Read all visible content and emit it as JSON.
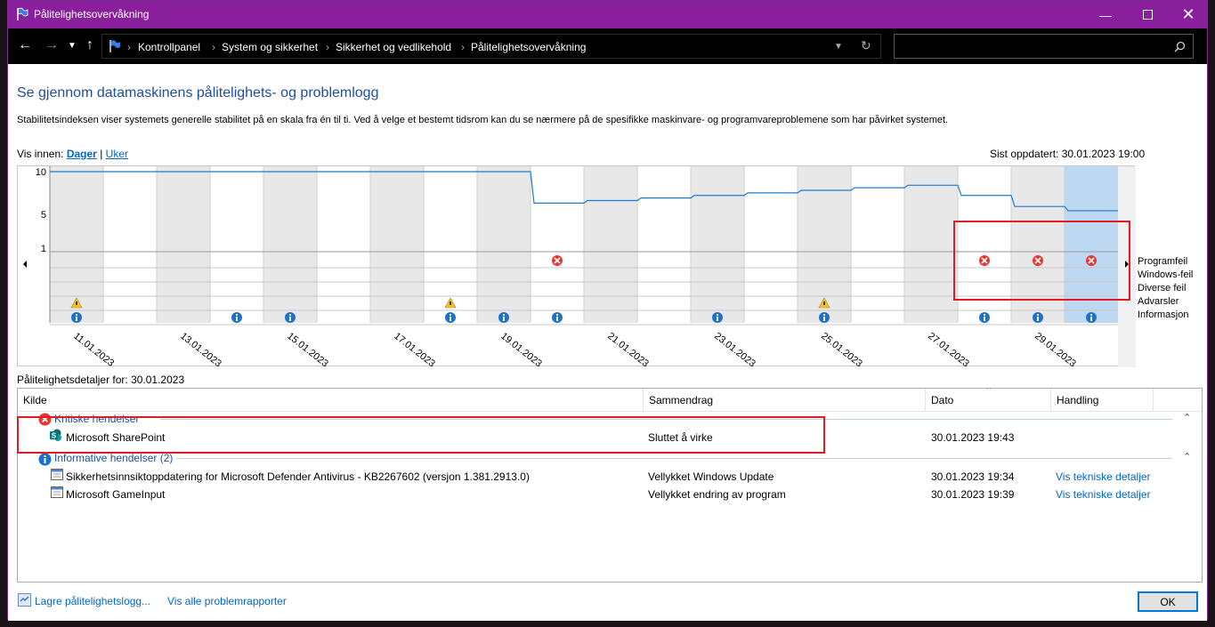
{
  "window": {
    "title": "Pålitelighetsovervåkning",
    "title_color": "#8a1f9e"
  },
  "address": {
    "crumbs": [
      "Kontrollpanel",
      "System og sikkerhet",
      "Sikkerhet og vedlikehold",
      "Pålitelighetsovervåkning"
    ]
  },
  "main": {
    "heading": "Se gjennom datamaskinens pålitelighets- og problemlogg",
    "description": "Stabilitetsindeksen viser systemets generelle stabilitet på en skala fra én til ti. Ved å velge et bestemt tidsrom kan du se nærmere på de spesifikke maskinvare- og programvareproblemene som har påvirket systemet.",
    "view_label": "Vis innen:",
    "view_days": "Dager",
    "view_sep": "|",
    "view_weeks": "Uker",
    "last_updated": "Sist oppdatert: 30.01.2023 19:00"
  },
  "chart_data": {
    "type": "line",
    "y_ticks": [
      "10",
      "5",
      "1"
    ],
    "ylim": [
      1,
      10
    ],
    "x_tick_labels": [
      "11.01.2023",
      "13.01.2023",
      "15.01.2023",
      "17.01.2023",
      "19.01.2023",
      "21.01.2023",
      "23.01.2023",
      "25.01.2023",
      "27.01.2023",
      "29.01.2023"
    ],
    "days": [
      "11.01",
      "12.01",
      "13.01",
      "14.01",
      "15.01",
      "16.01",
      "17.01",
      "18.01",
      "19.01",
      "20.01",
      "21.01",
      "22.01",
      "23.01",
      "24.01",
      "25.01",
      "26.01",
      "27.01",
      "28.01",
      "29.01",
      "30.01"
    ],
    "stability_index": [
      10,
      10,
      10,
      10,
      10,
      10,
      10,
      10,
      10,
      6.3,
      6.6,
      6.9,
      7.2,
      7.5,
      7.8,
      8.1,
      8.4,
      7.2,
      5.9,
      5.4
    ],
    "row_labels": [
      "Programfeil",
      "Windows-feil",
      "Diverse feil",
      "Advarsler",
      "Informasjon"
    ],
    "events": {
      "Programfeil": [
        "20.01",
        "28.01",
        "29.01",
        "30.01"
      ],
      "Advarsler": [
        "11.01",
        "18.01",
        "25.01"
      ],
      "Informasjon": [
        "11.01",
        "14.01",
        "15.01",
        "18.01",
        "19.01",
        "20.01",
        "23.01",
        "25.01",
        "28.01",
        "29.01",
        "30.01"
      ]
    },
    "selected_day": "30.01",
    "line_color": "#1c7cd5",
    "selected_color": "#bcd8f2"
  },
  "details": {
    "title": "Pålitelighetsdetaljer for: 30.01.2023",
    "columns": [
      "Kilde",
      "Sammendrag",
      "Dato",
      "Handling"
    ],
    "critical_group": "Kritiske hendelser",
    "critical_rows": [
      {
        "source": "Microsoft SharePoint",
        "summary": "Sluttet å virke",
        "date": "30.01.2023 19:43",
        "action": ""
      }
    ],
    "info_group": "Informative hendelser (2)",
    "info_rows": [
      {
        "source": "Sikkerhetsinnsiktoppdatering for Microsoft Defender Antivirus - KB2267602 (versjon 1.381.2913.0)",
        "summary": "Vellykket Windows Update",
        "date": "30.01.2023 19:34",
        "action": "Vis tekniske detaljer"
      },
      {
        "source": "Microsoft GameInput",
        "summary": "Vellykket endring av program",
        "date": "30.01.2023 19:39",
        "action": "Vis tekniske detaljer"
      }
    ]
  },
  "footer": {
    "save_link": "Lagre pålitelighetslogg...",
    "problems_link": "Vis alle problemrapporter",
    "ok_label": "OK"
  }
}
